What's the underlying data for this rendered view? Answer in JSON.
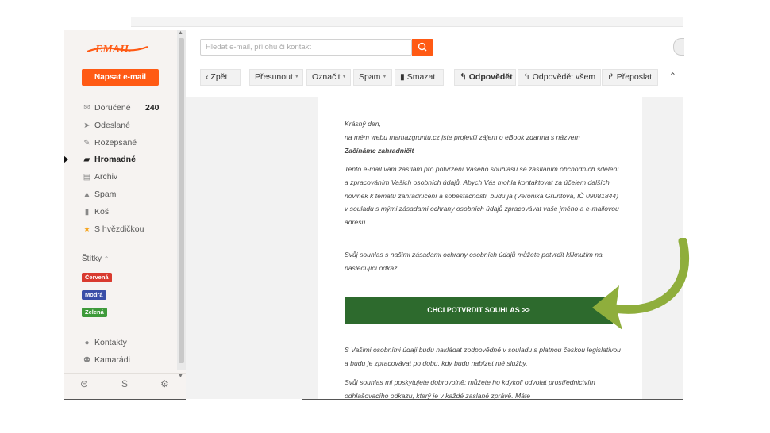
{
  "logo": {
    "text": "EMAIL"
  },
  "compose_label": "Napsat e-mail",
  "search": {
    "placeholder": "Hledat e-mail, přílohu či kontakt",
    "icon": "search-icon"
  },
  "toolbar": {
    "back": "Zpět",
    "move": "Přesunout",
    "mark": "Označit",
    "spam": "Spam",
    "delete": "Smazat",
    "reply": "Odpovědět",
    "reply_all": "Odpovědět všem",
    "forward": "Přeposlat"
  },
  "folders": [
    {
      "label": "Doručené",
      "count": "240",
      "icon": "inbox-icon"
    },
    {
      "label": "Odeslané",
      "icon": "send-icon"
    },
    {
      "label": "Rozepsané",
      "icon": "draft-icon"
    },
    {
      "label": "Hromadné",
      "icon": "bulk-icon",
      "active": true
    },
    {
      "label": "Archiv",
      "icon": "archive-icon"
    },
    {
      "label": "Spam",
      "icon": "warning-icon"
    },
    {
      "label": "Koš",
      "icon": "trash-icon"
    },
    {
      "label": "S hvězdičkou",
      "icon": "star-icon"
    }
  ],
  "labels_heading": "Štítky",
  "tags": [
    {
      "label": "Červená",
      "color": "#d93a2f"
    },
    {
      "label": "Modrá",
      "color": "#3a4fa8"
    },
    {
      "label": "Zelená",
      "color": "#3e9a3a"
    }
  ],
  "contacts": [
    {
      "label": "Kontakty",
      "icon": "contact-icon"
    },
    {
      "label": "Kamarádi",
      "icon": "friends-icon"
    }
  ],
  "email": {
    "greeting": "Krásný den,",
    "line1": "na mém webu mamazgruntu.cz jste projevili zájem o eBook zdarma s názvem",
    "title": "Začínáme zahradničit",
    "para1": "Tento e-mail vám zasílám pro potvrzení Vašeho souhlasu se zasíláním obchodních sdělení a zpracováním Vašich osobních údajů. Abych Vás mohla kontaktovat za účelem dalších novinek k tématu zahradničení a soběstačnosti, budu já (Veronika Gruntová,  IČ 09081844) v souladu s mými zásadami ochrany osobních údajů zpracovávat vaše jméno a e-mailovou adresu.",
    "para2": "Svůj souhlas s našimi zásadami ochrany osobních údajů můžete potvrdit kliknutím na následující odkaz.",
    "cta": "CHCI POTVRDIT SOUHLAS >>",
    "para3": "S Vašimi osobními údaji budu nakládat zodpovědně v souladu s platnou českou legislativou a budu je zpracovávat po dobu, kdy budu nabízet mé služby.",
    "para4": "Svůj souhlas mi poskytujete dobrovolně; můžete ho kdykoli odvolat prostřednictvím odhlašovacího odkazu, který je v každé zaslané zprávě. Máte"
  },
  "colors": {
    "accent": "#ff5a14",
    "cta": "#2d6a2d",
    "arrow": "#8fae3c"
  }
}
